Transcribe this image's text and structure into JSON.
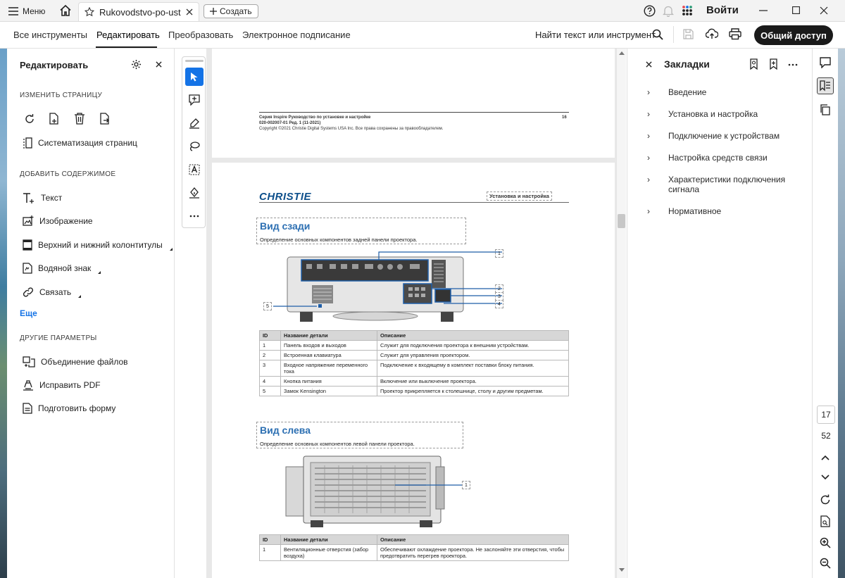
{
  "titlebar": {
    "menu_label": "Меню",
    "tab_title": "Rukovodstvo-po-ust...",
    "create_label": "Создать",
    "login_label": "Войти",
    "icons": [
      "menu-icon",
      "home-icon",
      "star-icon",
      "close-icon",
      "plus-icon",
      "help-icon",
      "bell-icon",
      "apps-icon",
      "minimize-icon",
      "maximize-icon",
      "close-window-icon"
    ]
  },
  "toolbar": {
    "tabs": [
      "Все инструменты",
      "Редактировать",
      "Преобразовать",
      "Электронное подписание"
    ],
    "active_tab": "Редактировать",
    "find_label": "Найти текст или инструмент",
    "share_label": "Общий доступ"
  },
  "left_panel": {
    "title": "Редактировать",
    "section_page": "ИЗМЕНИТЬ СТРАНИЦУ",
    "organize_label": "Систематизация страниц",
    "section_add": "ДОБАВИТЬ СОДЕРЖИМОЕ",
    "items": [
      "Текст",
      "Изображение",
      "Верхний и нижний колонтитулы",
      "Водяной знак",
      "Связать"
    ],
    "more_label": "Еще",
    "section_other": "ДРУГИЕ ПАРАМЕТРЫ",
    "other_items": [
      "Объединение файлов",
      "Исправить PDF",
      "Подготовить форму"
    ]
  },
  "document": {
    "page1_footer": {
      "line1": "Серия Inspire Руководство по установке и настройке",
      "page_num": "16",
      "line2": "020-002007-01 Ред. 1 (11-2021)",
      "line3": "Copyright ©2021 Christie Digital Systems USA Inc. Все права сохранены за правообладателем."
    },
    "logo": "CHRISTIE",
    "header_label": "Установка и настройка",
    "rear": {
      "heading": "Вид сзади",
      "subtitle": "Определение основных компонентов задней панели проектора.",
      "callouts": [
        "1",
        "2",
        "3",
        "4",
        "5"
      ],
      "table_headers": [
        "ID",
        "Название детали",
        "Описание"
      ],
      "rows": [
        [
          "1",
          "Панель входов и выходов",
          "Служит для подключения проектора к внешним устройствам."
        ],
        [
          "2",
          "Встроенная клавиатура",
          "Служит для управления проектором."
        ],
        [
          "3",
          "Входное напряжение переменного тока",
          "Подключение к входящему в комплект поставки блоку питания."
        ],
        [
          "4",
          "Кнопка питания",
          "Включение или выключение проектора."
        ],
        [
          "5",
          "Замок Kensington",
          "Проектор прикрепляется к столешнице, столу и другим предметам."
        ]
      ]
    },
    "left": {
      "heading": "Вид слева",
      "subtitle": "Определение основных компонентов левой панели проектора.",
      "callout": "1",
      "table_headers": [
        "ID",
        "Название детали",
        "Описание"
      ],
      "rows": [
        [
          "1",
          "Вентиляционные отверстия (забор воздуха)",
          "Обеспечивают охлаждение проектора. Не заслоняйте эти отверстия, чтобы предотвратить перегрев проектора."
        ]
      ]
    }
  },
  "bookmarks": {
    "title": "Закладки",
    "items": [
      "Введение",
      "Установка и настройка",
      "Подключение к устройствам",
      "Настройка средств связи",
      "Характеристики подключения сигнала",
      "Нормативное"
    ]
  },
  "page_nav": {
    "current": "17",
    "total": "52"
  }
}
